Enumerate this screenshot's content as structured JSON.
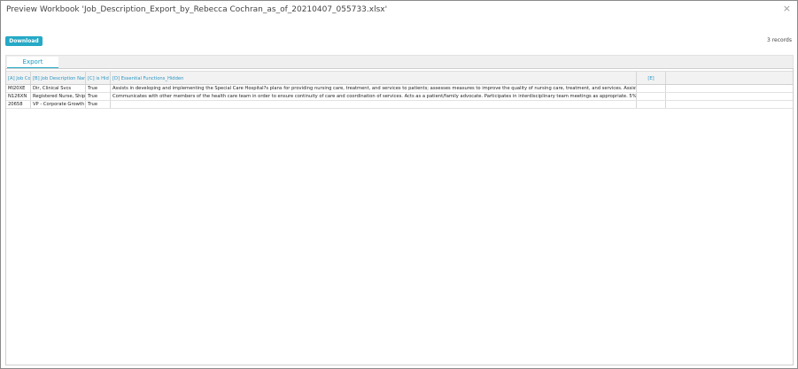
{
  "dialog": {
    "title": "Preview Workbook 'Job_Description_Export_by_Rebecca Cochran_as_of_20210407_055733.xlsx'",
    "close_glyph": "×",
    "download_label": "Download",
    "records_text": "3 records"
  },
  "tabs": [
    {
      "label": "Export",
      "active": true
    }
  ],
  "sheet": {
    "columns": [
      "[A] Job Co",
      "[B] Job Description Nam",
      "[C] is Hid",
      "[D] Essential Functions_Hidden",
      "[E]",
      ""
    ],
    "rows": [
      [
        "MI20XE",
        "Dir, Clinical Svcs",
        "True",
        "Assists in developing and implementing the Special Care Hospital?s plans for providing nursing care, treatment, and services to patients; assesses measures to improve the quality of nursing care, treatment, and services. Assists with the planning,",
        "",
        ""
      ],
      [
        "N126XN",
        "Registered Nurse, Ships",
        "True",
        "Communicates with other members of the health care team in order to ensure continuity of care and coordination of services.  Acts as a patient/family advocate.  Participates in interdisciplinary team meetings as appropriate. 5%",
        "",
        ""
      ],
      [
        "20658",
        "VP - Corporate Growth",
        "True",
        "",
        "",
        ""
      ]
    ]
  },
  "colors": {
    "accent": "#25a9c6",
    "header_text": "#2b97c4"
  }
}
